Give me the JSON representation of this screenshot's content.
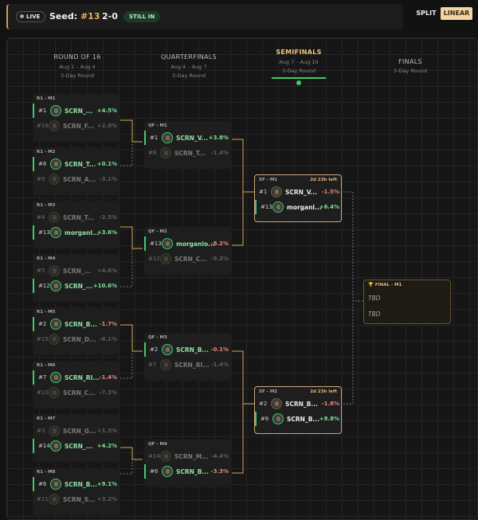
{
  "header": {
    "live": "LIVE",
    "seed_label": "Seed:",
    "seed_value": "#13",
    "record": "2-0",
    "status": "STILL IN",
    "split": "SPLIT",
    "linear": "LINEAR"
  },
  "rounds": {
    "r16": {
      "title": "ROUND OF 16",
      "dates": "Aug 1 – Aug 4",
      "sub": "3-Day Round"
    },
    "qf": {
      "title": "QUARTERFINALS",
      "dates": "Aug 4 – Aug 7",
      "sub": "3-Day Round"
    },
    "sf": {
      "title": "SEMIFINALS",
      "dates": "Aug 7 – Aug 10",
      "sub": "3-Day Round"
    },
    "fin": {
      "title": "FINALS",
      "sub": "3-Day Round"
    }
  },
  "r16": [
    {
      "label": "R1 - M1",
      "a": {
        "seed": "#1",
        "name": "SCRN_...",
        "pct": "+4.5%"
      },
      "b": {
        "seed": "#16",
        "name": "SCRN_F...",
        "pct": "+2.0%"
      }
    },
    {
      "label": "R1 - M2",
      "a": {
        "seed": "#8",
        "name": "SCRN_T...",
        "pct": "+0.1%"
      },
      "b": {
        "seed": "#9",
        "name": "SCRN_A...",
        "pct": "-3.1%"
      }
    },
    {
      "label": "R1 - M3",
      "a": {
        "seed": "#4",
        "name": "SCRN_T...",
        "pct": "-2.5%"
      },
      "b": {
        "seed": "#13",
        "name": "morganl...",
        "pct": "+3.6%"
      }
    },
    {
      "label": "R1 - M4",
      "a": {
        "seed": "#5",
        "name": "SCRN_...",
        "pct": "+4.6%"
      },
      "b": {
        "seed": "#12",
        "name": "SCRN_...",
        "pct": "+10.6%"
      }
    },
    {
      "label": "R1 - M5",
      "a": {
        "seed": "#2",
        "name": "SCRN_B...",
        "pct": "-1.7%"
      },
      "b": {
        "seed": "#15",
        "name": "SCRN_D...",
        "pct": "-6.1%"
      }
    },
    {
      "label": "R1 - M6",
      "a": {
        "seed": "#7",
        "name": "SCRN_RI...",
        "pct": "-1.4%"
      },
      "b": {
        "seed": "#10",
        "name": "SCRN_C...",
        "pct": "-7.3%"
      }
    },
    {
      "label": "R1 - M7",
      "a": {
        "seed": "#3",
        "name": "SCRN_G...",
        "pct": "+1.3%"
      },
      "b": {
        "seed": "#14",
        "name": "SCRN_...",
        "pct": "+4.2%"
      }
    },
    {
      "label": "R1 - M8",
      "a": {
        "seed": "#6",
        "name": "SCRN_B...",
        "pct": "+9.1%"
      },
      "b": {
        "seed": "#11",
        "name": "SCRN_S...",
        "pct": "+3.2%"
      }
    }
  ],
  "qf": [
    {
      "label": "QF - M1",
      "a": {
        "seed": "#1",
        "name": "SCRN_V...",
        "pct": "+3.8%"
      },
      "b": {
        "seed": "#8",
        "name": "SCRN_T...",
        "pct": "-1.4%"
      }
    },
    {
      "label": "QF - M2",
      "a": {
        "seed": "#13",
        "name": "morganlo...",
        "pct": "-8.2%"
      },
      "b": {
        "seed": "#12",
        "name": "SCRN_C...",
        "pct": "-9.2%"
      }
    },
    {
      "label": "QF - M3",
      "a": {
        "seed": "#2",
        "name": "SCRN_B...",
        "pct": "-0.1%"
      },
      "b": {
        "seed": "#7",
        "name": "SCRN_RI...",
        "pct": "-1.4%"
      }
    },
    {
      "label": "QF - M4",
      "a": {
        "seed": "#14",
        "name": "SCRN_M...",
        "pct": "-4.4%"
      },
      "b": {
        "seed": "#6",
        "name": "SCRN_B...",
        "pct": "-3.3%"
      }
    }
  ],
  "sf": [
    {
      "label": "SF - M1",
      "time": "2d 23h left",
      "a": {
        "seed": "#1",
        "name": "SCRN_V...",
        "pct": "-1.5%"
      },
      "b": {
        "seed": "#13",
        "name": "morganl...",
        "pct": "+6.4%"
      }
    },
    {
      "label": "SF - M2",
      "time": "2d 23h left",
      "a": {
        "seed": "#2",
        "name": "SCRN_B...",
        "pct": "-1.8%"
      },
      "b": {
        "seed": "#6",
        "name": "SCRN_B...",
        "pct": "+8.8%"
      }
    }
  ],
  "final": {
    "label": "FINAL - M1",
    "a": "TBD",
    "b": "TBD"
  }
}
